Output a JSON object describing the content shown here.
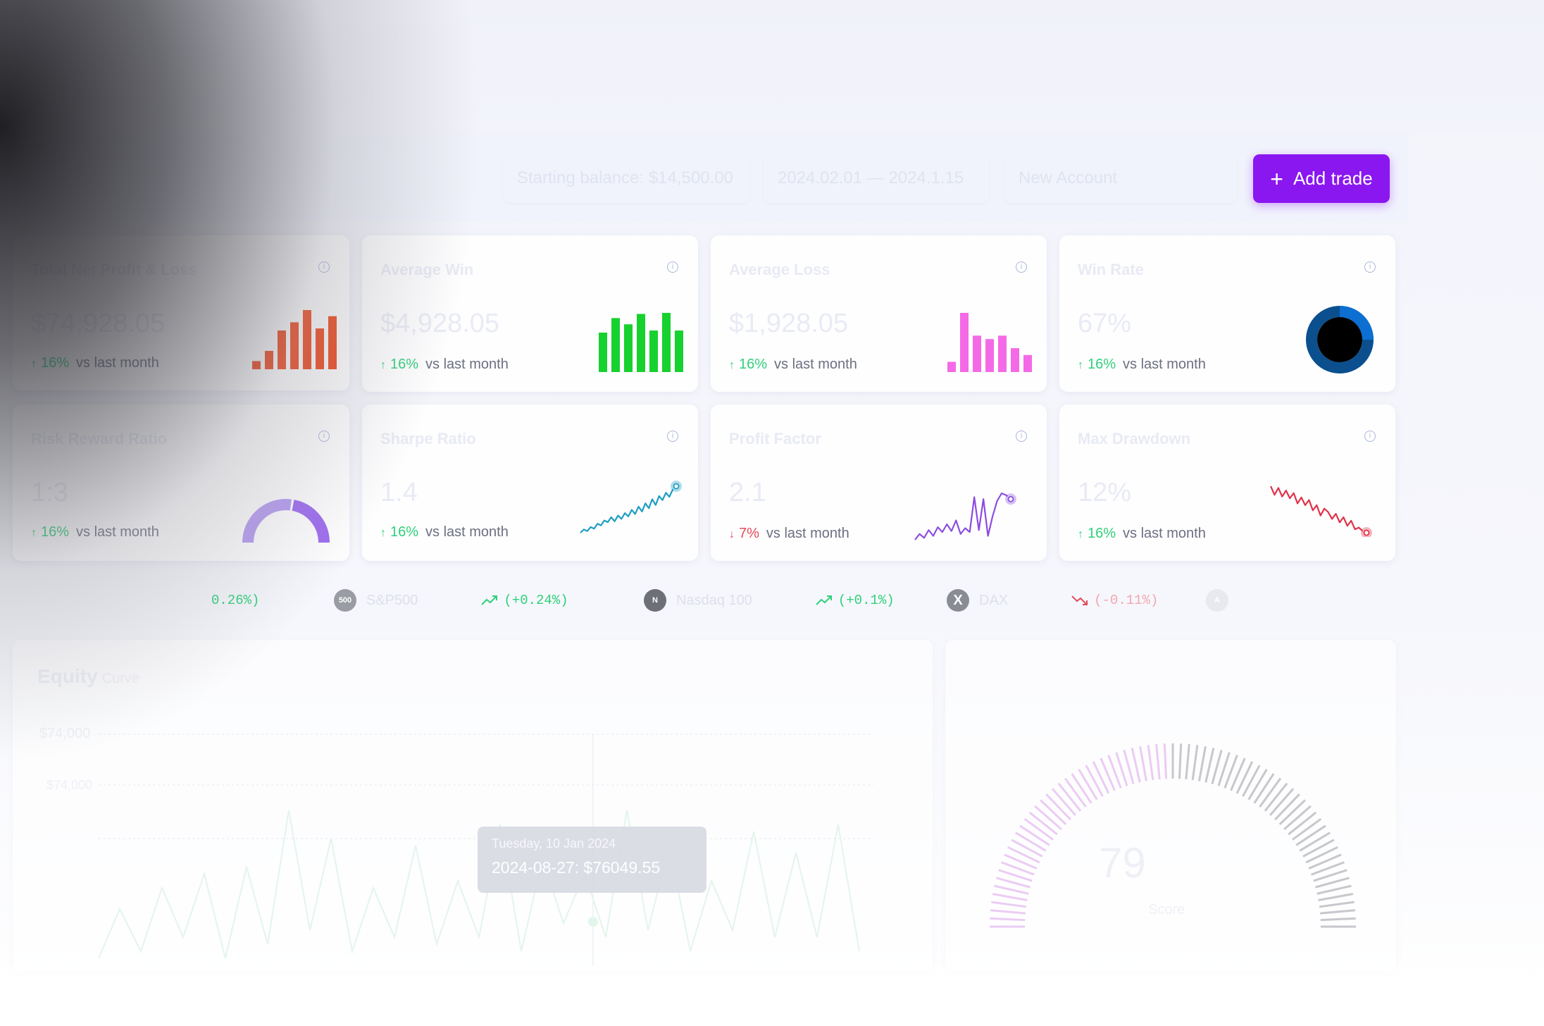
{
  "header": {
    "starting_balance": "Starting balance: $14,500.00",
    "date_range": "2024.02.01 — 2024.1.15",
    "account": "New Account",
    "add_trade_label": "Add trade",
    "add_trade_icon": "plus-icon"
  },
  "colors": {
    "accent": "#8a17f0",
    "up": "#2fd07a",
    "down": "#e24a5a"
  },
  "cards": [
    {
      "title": "Total Net Profit & Loss",
      "value": "$74,928.05",
      "arrow": "↑",
      "change": "16%",
      "suffix": "vs last month",
      "chart": "bar",
      "color": "#f0451a",
      "bar_values": [
        8,
        18,
        38,
        46,
        58,
        40,
        52
      ]
    },
    {
      "title": "Average Win",
      "value": "$4,928.05",
      "arrow": "↑",
      "change": "16%",
      "suffix": "vs last month",
      "chart": "bar",
      "color": "#17d12f",
      "bar_values": [
        38,
        52,
        46,
        56,
        40,
        57,
        40
      ]
    },
    {
      "title": "Average Loss",
      "value": "$1,928.05",
      "arrow": "↑",
      "change": "16%",
      "suffix": "vs last month",
      "chart": "bar",
      "color": "#f46ae6",
      "bar_values": [
        9,
        52,
        32,
        29,
        32,
        21,
        15
      ]
    },
    {
      "title": "Win Rate",
      "value": "67%",
      "arrow": "↑",
      "change": "16%",
      "suffix": "vs last month",
      "chart": "donut",
      "color": "#0c6fd1",
      "donut_fraction": 0.25
    },
    {
      "title": "Risk Reward Ratio",
      "value": "1:3",
      "arrow": "↑",
      "change": "16%",
      "suffix": "vs last month",
      "chart": "gauge",
      "color": "#9e6cf0",
      "gauge_fraction": 0.55
    },
    {
      "title": "Sharpe Ratio",
      "value": "1.4",
      "arrow": "↑",
      "change": "16%",
      "suffix": "vs last month",
      "chart": "line",
      "color": "#1d9dc2",
      "line_values": [
        5,
        9,
        7,
        12,
        10,
        16,
        14,
        20,
        18,
        24,
        19,
        26,
        22,
        29,
        25,
        33,
        28,
        37,
        31,
        41,
        35,
        46,
        39,
        50,
        45,
        54,
        49,
        58,
        62
      ]
    },
    {
      "title": "Profit Factor",
      "value": "2.1",
      "arrow": "↓",
      "change": "7%",
      "suffix": "vs last month",
      "chart": "line",
      "color": "#8b4ce0",
      "line_values": [
        6,
        12,
        8,
        16,
        10,
        19,
        14,
        22,
        15,
        26,
        12,
        18,
        14,
        50,
        16,
        48,
        10,
        30,
        46,
        54,
        52,
        48
      ]
    },
    {
      "title": "Max Drawdown",
      "value": "12%",
      "arrow": "↑",
      "change": "16%",
      "suffix": "vs last month",
      "chart": "line",
      "color": "#e03249",
      "line_values": [
        60,
        50,
        58,
        48,
        55,
        46,
        52,
        40,
        47,
        38,
        44,
        32,
        38,
        26,
        34,
        30,
        22,
        28,
        18,
        24,
        14,
        20,
        10,
        12,
        8,
        6
      ]
    }
  ],
  "tickers": [
    {
      "name": "",
      "logo": "",
      "delta": "0.26%)",
      "dir": "up"
    },
    {
      "name": "S&P500",
      "logo": "500",
      "delta": "(+0.24%)",
      "dir": "up"
    },
    {
      "name": "Nasdaq 100",
      "logo": "N",
      "delta": "(+0.1%)",
      "dir": "up"
    },
    {
      "name": "DAX",
      "logo": "X",
      "delta": "(-0.11%)",
      "dir": "down"
    },
    {
      "name": "",
      "logo": "A",
      "delta": "",
      "dir": "up"
    }
  ],
  "equity": {
    "title": "Equity",
    "subtitle": "Curve",
    "y_tick_1": "$74,000",
    "y_tick_2": "$74,000",
    "tooltip_date": "Tuesday, 10 Jan 2024",
    "tooltip_value": "2024-08-27: $76049.55"
  },
  "score": {
    "value": "79",
    "label": "Score",
    "gauge_fraction": 0.5
  }
}
